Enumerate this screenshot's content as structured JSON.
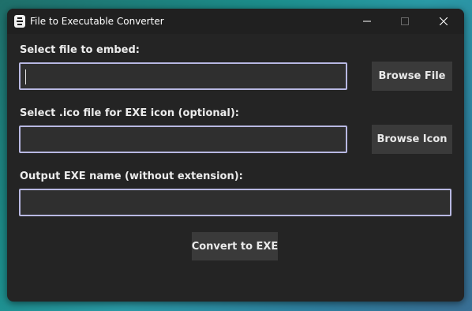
{
  "window": {
    "title": "File to Executable Converter"
  },
  "form": {
    "embed_label": "Select file to embed:",
    "embed_value": "",
    "icon_label": "Select .ico file for EXE icon (optional):",
    "icon_value": "",
    "output_label": "Output EXE name (without extension):",
    "output_value": ""
  },
  "buttons": {
    "browse_file": "Browse File",
    "browse_icon": "Browse Icon",
    "convert": "Convert to EXE"
  },
  "icons": {
    "app": "app-icon",
    "minimize": "minimize-icon",
    "maximize": "maximize-icon",
    "close": "close-icon"
  },
  "colors": {
    "window_bg": "#242424",
    "field_bg": "#2f2f2f",
    "field_border": "#b8b8e2",
    "button_bg": "#3a3a3a"
  }
}
